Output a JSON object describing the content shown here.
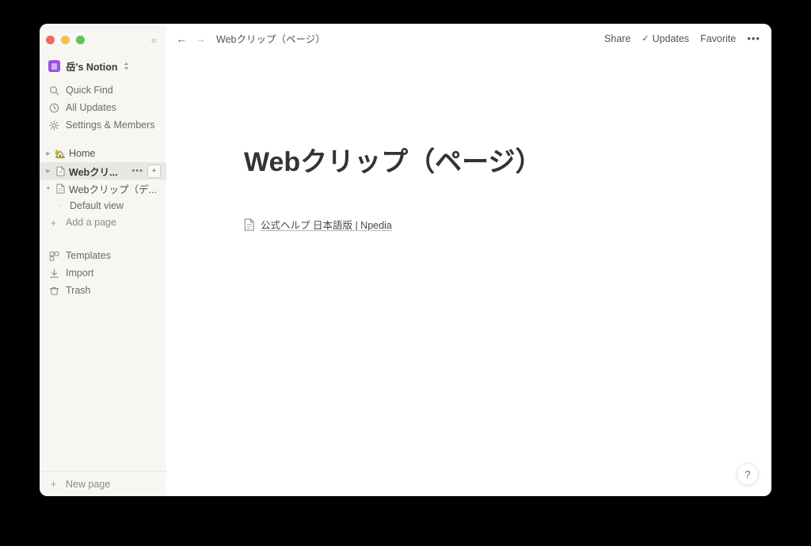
{
  "window": {
    "traffic_lights": [
      {
        "name": "close",
        "color": "#ed6a5e"
      },
      {
        "name": "minimize",
        "color": "#f4bd4f"
      },
      {
        "name": "zoom",
        "color": "#61c454"
      }
    ],
    "collapse_icon": "«"
  },
  "sidebar": {
    "workspace": {
      "name": "岳's Notion",
      "icon_color": "#9b51e0",
      "chevron": "⇅"
    },
    "nav_items": [
      {
        "label": "Quick Find",
        "icon": "search-icon"
      },
      {
        "label": "All Updates",
        "icon": "clock-icon"
      },
      {
        "label": "Settings & Members",
        "icon": "gear-icon"
      }
    ],
    "tree_items": [
      {
        "label": "Home",
        "icon": "house-emoji",
        "emoji": "🏡",
        "triangle": "▶",
        "expanded": false,
        "selected": false,
        "has_actions": false
      },
      {
        "label": "Webクリ...",
        "icon": "page-icon",
        "triangle": "▶",
        "expanded": false,
        "selected": true,
        "has_actions": true,
        "actions": {
          "more": "•••",
          "add": "+"
        }
      },
      {
        "label": "Webクリップ（デ...",
        "icon": "page-icon",
        "triangle": "▼",
        "expanded": true,
        "selected": false,
        "has_actions": false
      }
    ],
    "sub_items": [
      {
        "label": "Default view",
        "bullet": "·"
      }
    ],
    "add_a_page": {
      "label": "Add a page",
      "icon": "plus-icon"
    },
    "bottom_items": [
      {
        "label": "Templates",
        "icon": "templates-icon"
      },
      {
        "label": "Import",
        "icon": "import-icon"
      },
      {
        "label": "Trash",
        "icon": "trash-icon"
      }
    ],
    "footer": {
      "label": "New page",
      "icon": "plus-icon"
    }
  },
  "topbar": {
    "back_arrow": "←",
    "forward_arrow": "→",
    "breadcrumb": "Webクリップ（ページ）",
    "share_label": "Share",
    "updates_label": "Updates",
    "updates_check": "✓",
    "favorite_label": "Favorite",
    "more_menu": "•••"
  },
  "page": {
    "title": "Webクリップ（ページ）",
    "link": {
      "text": "公式ヘルプ 日本語版 | Npedia",
      "icon": "page-icon"
    }
  },
  "help": {
    "label": "?"
  }
}
